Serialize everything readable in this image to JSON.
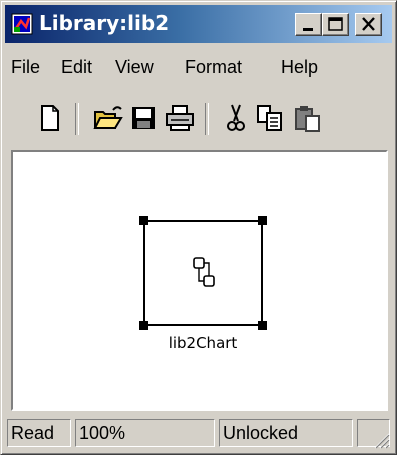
{
  "window": {
    "title": "Library:lib2",
    "icon": "simulink-library-icon",
    "controls": [
      "minimize-icon",
      "maximize-icon",
      "close-icon"
    ]
  },
  "menu": {
    "items": [
      "File",
      "Edit",
      "View",
      "Format",
      "Help"
    ]
  },
  "toolbar": {
    "tools": [
      "new-document-icon",
      "open-folder-icon",
      "save-icon",
      "print-icon",
      "cut-icon",
      "copy-icon",
      "paste-icon"
    ]
  },
  "canvas": {
    "block": {
      "label": "lib2Chart",
      "icon": "stateflow-chart-icon"
    }
  },
  "status": {
    "mode": "Read",
    "zoom": "100%",
    "lock": "Unlocked"
  },
  "colors": {
    "title_active_start": "#0a246a",
    "title_active_end": "#a6caf0",
    "face": "#d4d0c8",
    "canvas": "#ffffff"
  }
}
